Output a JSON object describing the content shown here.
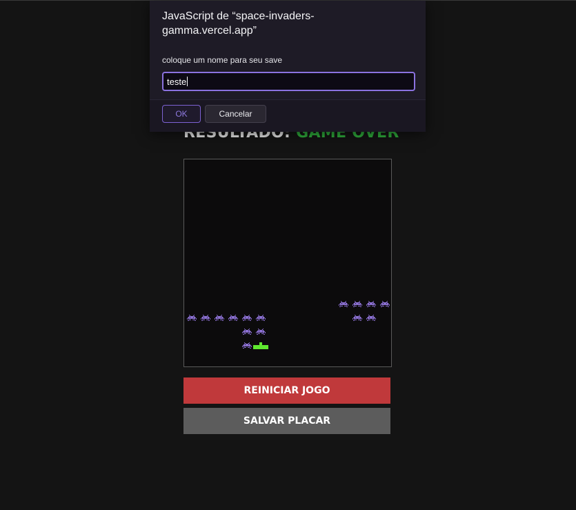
{
  "game": {
    "result_label": "RESULTADO:",
    "result_status": "GAME OVER",
    "result_color": "#2fae3c",
    "invader_color": "#8a6fd0",
    "player_color": "#5fe82f"
  },
  "buttons": {
    "restart_label": "REINICIAR JOGO",
    "save_label": "SALVAR PLACAR"
  },
  "dialog": {
    "title": "JavaScript de “space-invaders-gamma.vercel.app”",
    "message": "coloque um nome para seu save",
    "input_value": "teste",
    "ok_label": "OK",
    "cancel_label": "Cancelar"
  }
}
